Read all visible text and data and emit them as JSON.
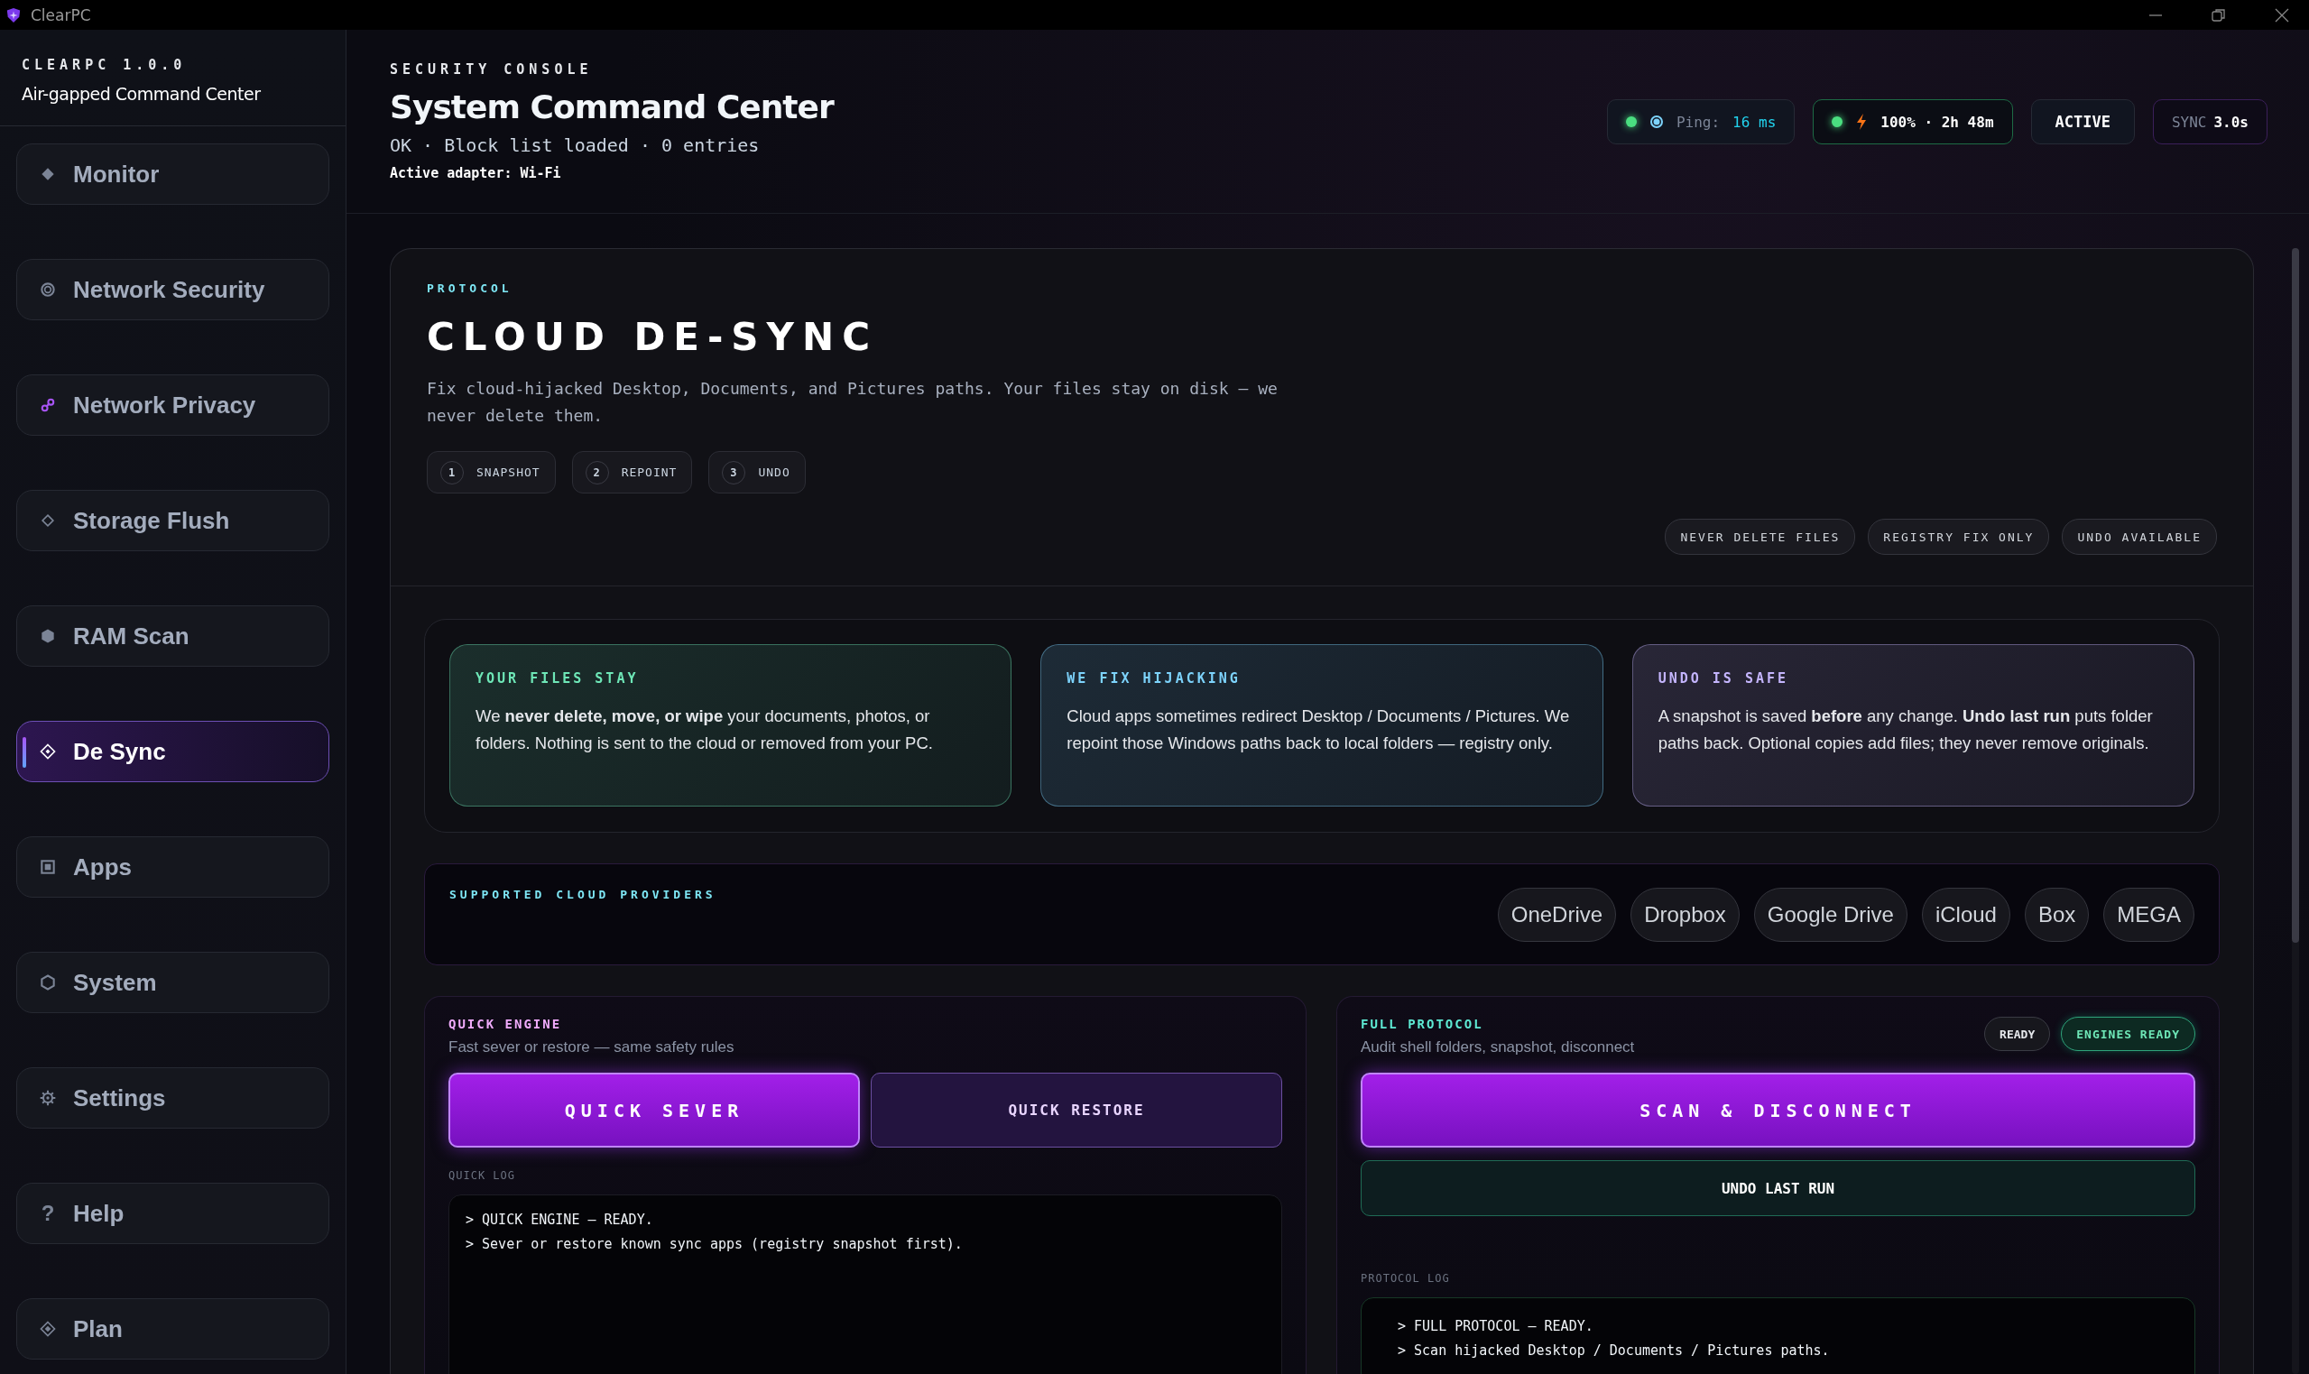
{
  "window": {
    "title": "ClearPC"
  },
  "sidebar": {
    "version": "CLEARPC 1.0.0",
    "subtitle": "Air-gapped Command Center",
    "items": [
      {
        "label": "Monitor",
        "selected": false
      },
      {
        "label": "Network Security",
        "selected": false
      },
      {
        "label": "Network Privacy",
        "selected": false
      },
      {
        "label": "Storage Flush",
        "selected": false
      },
      {
        "label": "RAM Scan",
        "selected": false
      },
      {
        "label": "De Sync",
        "selected": true
      },
      {
        "label": "Apps",
        "selected": false
      },
      {
        "label": "System",
        "selected": false
      },
      {
        "label": "Settings",
        "selected": false
      },
      {
        "label": "Help",
        "glyph": "?",
        "selected": false
      },
      {
        "label": "Plan",
        "selected": false
      }
    ]
  },
  "header": {
    "eyebrow": "SECURITY CONSOLE",
    "title": "System Command Center",
    "status": "OK · Block list loaded · 0 entries",
    "adapter": "Active adapter: Wi-Fi",
    "ping": {
      "label": "Ping:",
      "value": "16 ms"
    },
    "battery": "100% · 2h 48m",
    "mode": "ACTIVE",
    "sync": {
      "label": "SYNC",
      "value": "3.0s"
    }
  },
  "protocol": {
    "eyebrow": "PROTOCOL",
    "title": "CLOUD DE-SYNC",
    "description": "Fix cloud-hijacked Desktop, Documents, and Pictures paths. Your files stay on disk — we never delete them.",
    "steps": [
      {
        "number": "1",
        "label": "SNAPSHOT"
      },
      {
        "number": "2",
        "label": "REPOINT"
      },
      {
        "number": "3",
        "label": "UNDO"
      }
    ],
    "tags": [
      "NEVER DELETE FILES",
      "REGISTRY FIX ONLY",
      "UNDO AVAILABLE"
    ]
  },
  "info_cards": [
    {
      "title": "YOUR FILES STAY",
      "color": "#6ee7b7",
      "text": "We **never delete, move, or wipe** your documents, photos, or folders. Nothing is sent to the cloud or removed from your PC."
    },
    {
      "title": "WE FIX HIJACKING",
      "color": "#7dd3fc",
      "text": "Cloud apps sometimes redirect Desktop / Documents / Pictures. We repoint those Windows paths back to local folders — registry only."
    },
    {
      "title": "UNDO IS SAFE",
      "color": "#c4b5fd",
      "text": "A snapshot is saved **before** any change. **Undo last run** puts folder paths back. Optional copies add files; they never remove originals."
    }
  ],
  "providers": {
    "title": "SUPPORTED CLOUD PROVIDERS",
    "items": [
      "OneDrive",
      "Dropbox",
      "Google Drive",
      "iCloud",
      "Box",
      "MEGA"
    ]
  },
  "quick_engine": {
    "title": "QUICK ENGINE",
    "subtitle": "Fast sever or restore — same safety rules",
    "buttons": [
      {
        "label": "QUICK SEVER",
        "kind": "primary"
      },
      {
        "label": "QUICK RESTORE",
        "kind": "secondary"
      }
    ],
    "log_title": "QUICK LOG",
    "log": [
      "> QUICK ENGINE — READY.",
      "> Sever or restore known sync apps (registry snapshot first)."
    ]
  },
  "full_protocol": {
    "title": "FULL PROTOCOL",
    "subtitle": "Audit shell folders, snapshot, disconnect",
    "badges": [
      {
        "label": "READY",
        "kind": "neutral"
      },
      {
        "label": "ENGINES READY",
        "kind": "success"
      }
    ],
    "buttons": [
      {
        "label": "SCAN & DISCONNECT",
        "kind": "primary"
      },
      {
        "label": "UNDO LAST RUN",
        "kind": "outline"
      }
    ],
    "log_title": "PROTOCOL LOG",
    "log": [
      "> FULL PROTOCOL — READY.",
      "> Scan hijacked Desktop / Documents / Pictures paths."
    ]
  }
}
